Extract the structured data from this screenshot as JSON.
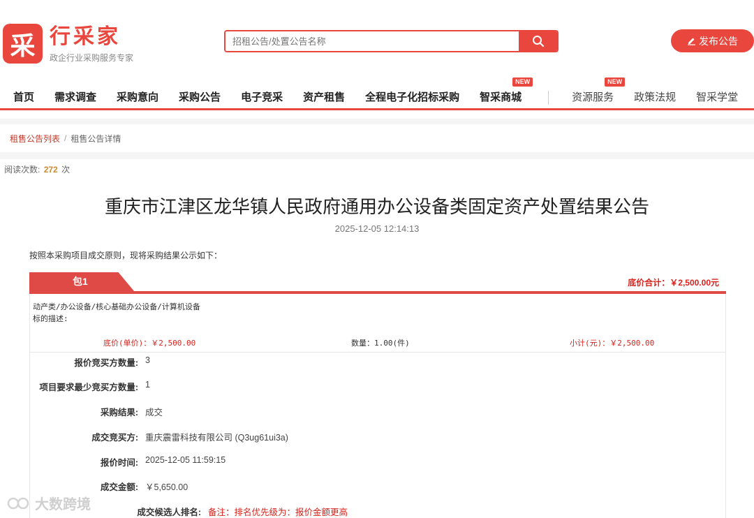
{
  "brand": {
    "logo_glyph": "采",
    "name": "行采家",
    "tagline": "政企行业采购服务专家",
    "accent": "#e9473d"
  },
  "search": {
    "placeholder": "招租公告/处置公告名称",
    "icon": "search-icon"
  },
  "publish": {
    "label": "发布公告",
    "icon": "edit-icon"
  },
  "nav": {
    "items": [
      {
        "label": "首页"
      },
      {
        "label": "需求调查"
      },
      {
        "label": "采购意向"
      },
      {
        "label": "采购公告"
      },
      {
        "label": "电子竞采"
      },
      {
        "label": "资产租售"
      },
      {
        "label": "全程电子化招标采购"
      },
      {
        "label": "智采商城",
        "badge": "NEW"
      }
    ],
    "secondary": [
      {
        "label": "资源服务",
        "badge": "NEW"
      },
      {
        "label": "政策法规"
      },
      {
        "label": "智采学堂"
      }
    ]
  },
  "breadcrumb": {
    "link": "租售公告列表",
    "sep": "/",
    "current": "租售公告详情"
  },
  "reads": {
    "prefix": "阅读次数:",
    "count": "272",
    "suffix": "次"
  },
  "notice": {
    "title": "重庆市江津区龙华镇人民政府通用办公设备类固定资产处置结果公告",
    "datetime": "2025-12-05 12:14:13",
    "intro": "按照本采购项目成交原则，现将采购结果公示如下："
  },
  "package": {
    "tab": "包1",
    "total": "底价合计：￥2,500.00元",
    "category": "动产类/办公设备/核心基础办公设备/计算机设备",
    "desc_label": "标的描述:",
    "unit_price": "底价(单价)：￥2,500.00",
    "quantity": "数量：1.00(件)",
    "subtotal": "小计(元)：￥2,500.00"
  },
  "details": [
    {
      "label": "报价竞买方数量:",
      "value": "3"
    },
    {
      "label": "项目要求最少竞买方数量:",
      "value": "1"
    },
    {
      "label": "采购结果:",
      "value": "成交"
    },
    {
      "label": "成交竞买方:",
      "value": "重庆震雷科技有限公司 (Q3ug61ui3a)"
    },
    {
      "label": "报价时间:",
      "value": "2025-12-05 11:59:15"
    },
    {
      "label": "成交金额:",
      "value": "￥5,650.00"
    },
    {
      "label": "成交候选人排名:",
      "value": "备注：排名优先级为：报价金额更高"
    }
  ],
  "watermark": "大数跨境"
}
